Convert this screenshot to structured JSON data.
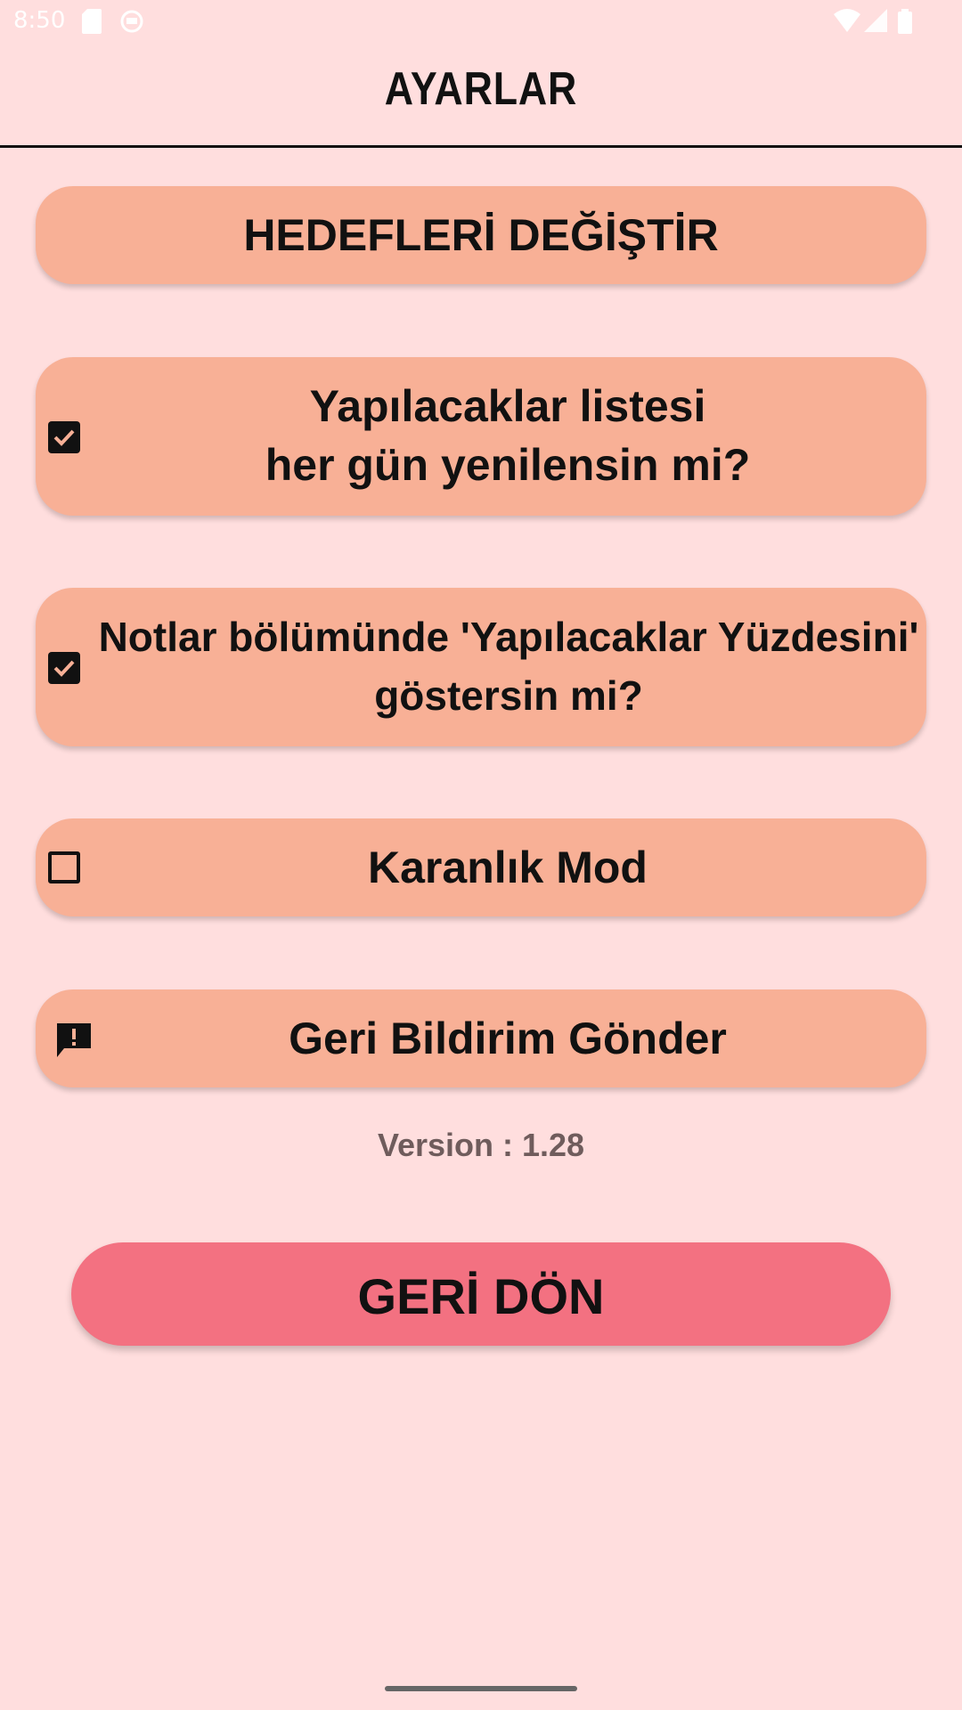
{
  "status_bar": {
    "time": "8:50"
  },
  "header": {
    "title": "AYARLAR"
  },
  "settings": {
    "change_goals_label": "HEDEFLERİ DEĞİŞTİR",
    "daily_reset": {
      "line1": "Yapılacaklar listesi",
      "line2": "her gün yenilensin mi?",
      "checked": true
    },
    "show_percentage": {
      "line1": "Notlar bölümünde 'Yapılacaklar Yüzdesini'",
      "line2": "göstersin mi?",
      "checked": true
    },
    "dark_mode": {
      "label": "Karanlık Mod",
      "checked": false
    },
    "feedback_label": "Geri Bildirim Gönder"
  },
  "version_text": "Version : 1.28",
  "back_button_label": "GERİ DÖN",
  "colors": {
    "background": "#FFDEDE",
    "card": "#F8B096",
    "back_button": "#F37181"
  },
  "icons": {
    "feedback": "feedback-icon",
    "checkbox_checked": "check-icon"
  }
}
